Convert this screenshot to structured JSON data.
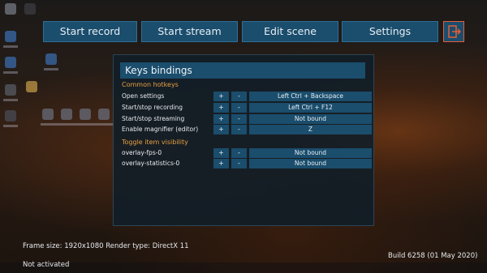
{
  "toolbar": {
    "start_record": "Start record",
    "start_stream": "Start stream",
    "edit_scene": "Edit scene",
    "settings": "Settings",
    "exit_icon": "exit-icon",
    "exit_color": "#e0603a"
  },
  "dialog": {
    "title": "Keys bindings",
    "sections": [
      {
        "title": "Common hotkeys",
        "rows": [
          {
            "label": "Open settings",
            "add": "+",
            "remove": "-",
            "binding": "Left Ctrl + Backspace"
          },
          {
            "label": "Start/stop recording",
            "add": "+",
            "remove": "-",
            "binding": "Left Ctrl + F12"
          },
          {
            "label": "Start/stop streaming",
            "add": "+",
            "remove": "-",
            "binding": "Not bound"
          },
          {
            "label": "Enable magnifier (editor)",
            "add": "+",
            "remove": "-",
            "binding": "Z"
          }
        ]
      },
      {
        "title": "Toggle item visibility",
        "rows": [
          {
            "label": "overlay-fps-0",
            "add": "+",
            "remove": "-",
            "binding": "Not bound"
          },
          {
            "label": "overlay-statistics-0",
            "add": "+",
            "remove": "-",
            "binding": "Not bound"
          }
        ]
      }
    ]
  },
  "status": {
    "frame_info": "Frame size: 1920x1080 Render type: DirectX 11",
    "build": "Build 6258 (01 May 2020)",
    "activation": "Not activated"
  },
  "colors": {
    "button_bg": "#1b4d6c",
    "section_title": "#e8a040",
    "panel_bg": "#101e28"
  }
}
